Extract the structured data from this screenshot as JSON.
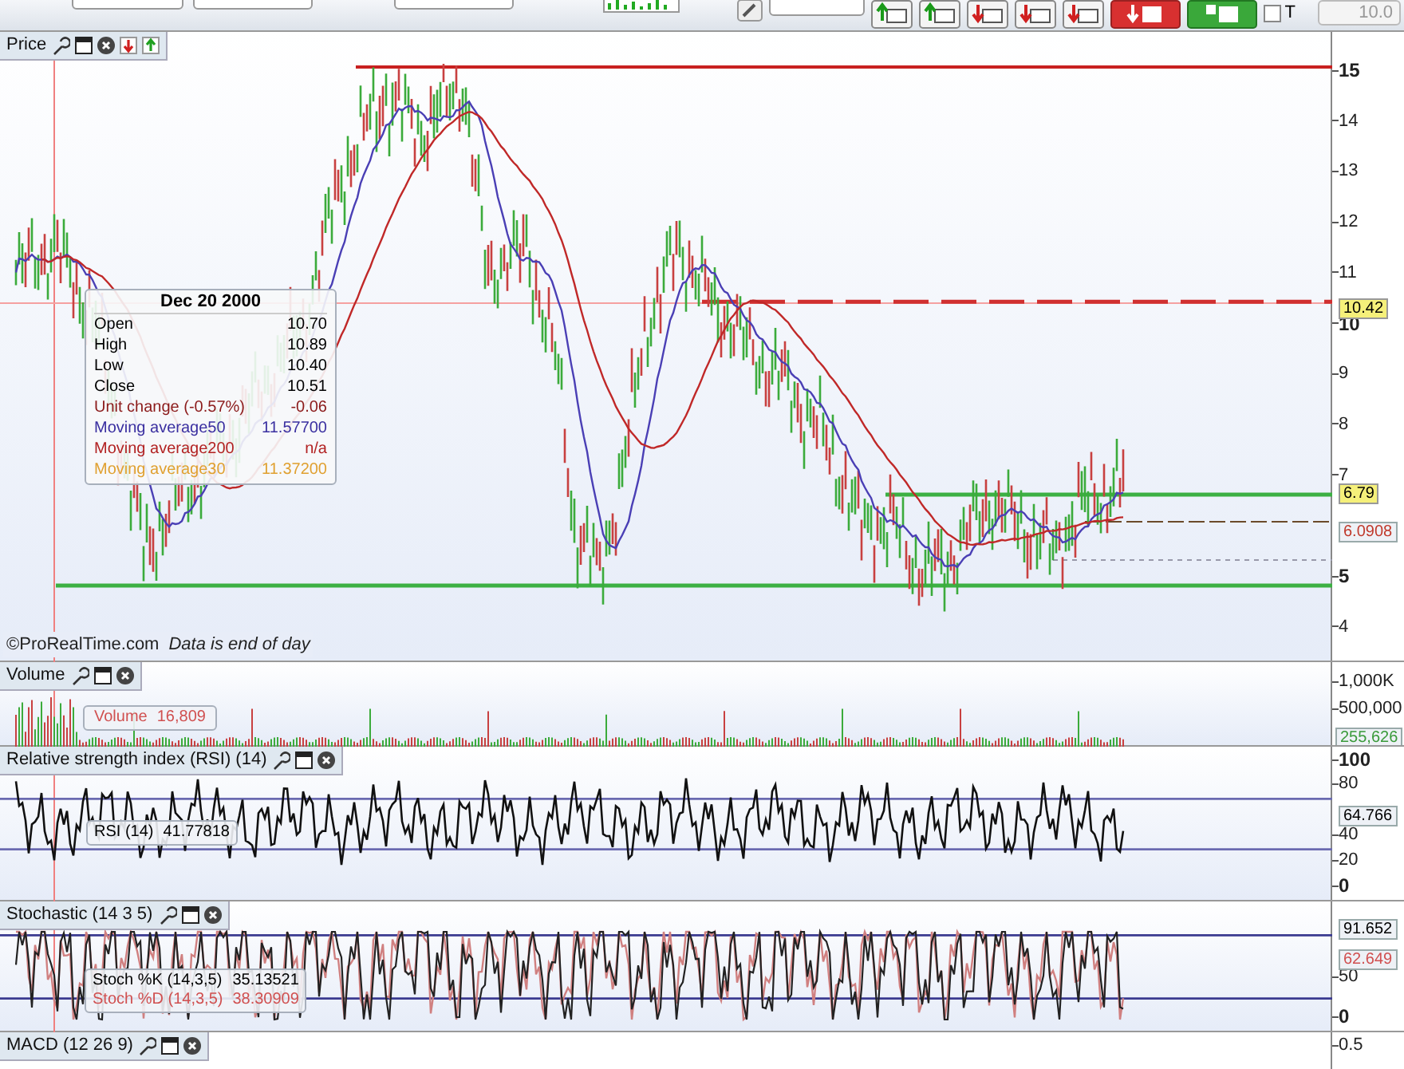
{
  "toolbar": {
    "checkbox": {
      "label": "T",
      "checked": false
    },
    "quantity": {
      "value": "10.0",
      "disabled": true
    }
  },
  "price_panel": {
    "title": "Price",
    "y_ticks": [
      {
        "label": "15",
        "major": true
      },
      {
        "label": "14",
        "major": false
      },
      {
        "label": "13",
        "major": false
      },
      {
        "label": "12",
        "major": false
      },
      {
        "label": "11",
        "major": false
      },
      {
        "label": "10",
        "major": true
      },
      {
        "label": "9",
        "major": false
      },
      {
        "label": "8",
        "major": false
      },
      {
        "label": "7",
        "major": false
      },
      {
        "label": "5",
        "major": true
      },
      {
        "label": "4",
        "major": false
      }
    ],
    "tags": [
      {
        "text": "10.42",
        "kind": "highlight"
      },
      {
        "text": "6.79",
        "kind": "highlight"
      },
      {
        "text": "6.0908",
        "kind": "plain",
        "color": "#c0392b"
      }
    ],
    "tooltip": {
      "date": "Dec 20 2000",
      "rows": [
        {
          "label": "Open",
          "value": "10.70",
          "color": "#000000"
        },
        {
          "label": "High",
          "value": "10.89",
          "color": "#000000"
        },
        {
          "label": "Low",
          "value": "10.40",
          "color": "#000000"
        },
        {
          "label": "Close",
          "value": "10.51",
          "color": "#000000"
        },
        {
          "label": "Unit change (-0.57%)",
          "value": "-0.06",
          "color": "#8b1a1a"
        },
        {
          "label": "Moving average50",
          "value": "11.57700",
          "color": "#3a2fa0"
        },
        {
          "label": "Moving average200",
          "value": "n/a",
          "color": "#b22222"
        },
        {
          "label": "Moving average30",
          "value": "11.37200",
          "color": "#e0a030"
        }
      ]
    },
    "credit": "©ProRealTime.com",
    "note": "Data is end of day"
  },
  "volume_panel": {
    "title": "Volume",
    "readout": {
      "label": "Volume",
      "value": "16,809"
    },
    "y_ticks": [
      "1,000K",
      "500,000"
    ],
    "tags": [
      {
        "text": "255,626",
        "kind": "plain",
        "color": "#3a9a3a"
      }
    ]
  },
  "rsi_panel": {
    "title": "Relative strength index (RSI) (14)",
    "readouts": [
      {
        "label": "RSI (14)",
        "value": "41.77818",
        "color": "#000000"
      }
    ],
    "y_ticks": [
      {
        "label": "100",
        "major": true
      },
      {
        "label": "80",
        "major": false
      },
      {
        "label": "40",
        "major": false
      },
      {
        "label": "20",
        "major": false
      },
      {
        "label": "0",
        "major": true
      }
    ],
    "tags": [
      {
        "text": "64.766",
        "kind": "plain",
        "color": "#000000"
      }
    ]
  },
  "stochastic_panel": {
    "title": "Stochastic (14 3 5)",
    "readouts": [
      {
        "label": "Stoch %K (14,3,5)",
        "value": "35.13521",
        "color": "#000000"
      },
      {
        "label": "Stoch %D (14,3,5)",
        "value": "38.30909",
        "color": "#d05050"
      }
    ],
    "y_ticks": [
      {
        "label": "50",
        "major": false
      },
      {
        "label": "0",
        "major": true
      }
    ],
    "tags": [
      {
        "text": "91.652",
        "kind": "plain",
        "color": "#000000"
      },
      {
        "text": "62.649",
        "kind": "plain",
        "color": "#d05050"
      }
    ]
  },
  "macd_panel": {
    "title": "MACD (12 26 9)",
    "y_ticks": [
      "0.5"
    ]
  }
}
